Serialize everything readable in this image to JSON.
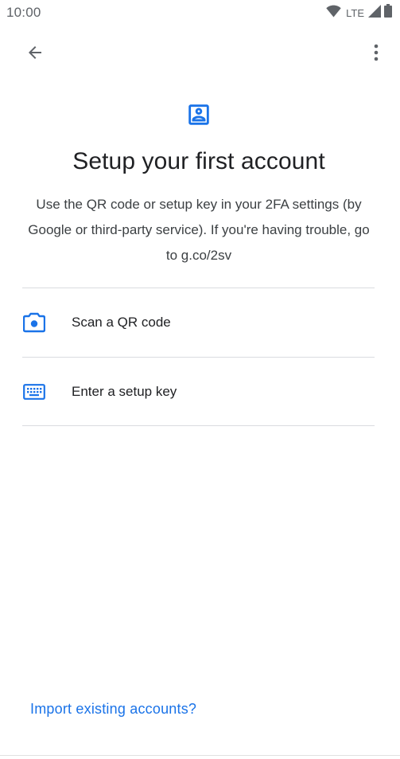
{
  "status_bar": {
    "time": "10:00",
    "network_label": "LTE",
    "icons": [
      "wifi-icon",
      "cell-signal-icon",
      "battery-icon"
    ]
  },
  "toolbar": {
    "back_icon": "arrow-back-icon",
    "more_icon": "more-vert-icon"
  },
  "header": {
    "icon": "account-box-icon",
    "title": "Setup your first account",
    "description": "Use the QR code or setup key in your 2FA settings (by Google or third-party service). If you're having trouble, go to g.co/2sv"
  },
  "options": [
    {
      "icon": "camera-icon",
      "label": "Scan a QR code"
    },
    {
      "icon": "keyboard-icon",
      "label": "Enter a setup key"
    }
  ],
  "footer": {
    "import_link": "Import existing accounts?"
  },
  "colors": {
    "accent": "#1a73e8",
    "text_primary": "#202124",
    "text_secondary": "#3c4043",
    "icon_grey": "#5f6368",
    "divider": "#dadce0"
  }
}
